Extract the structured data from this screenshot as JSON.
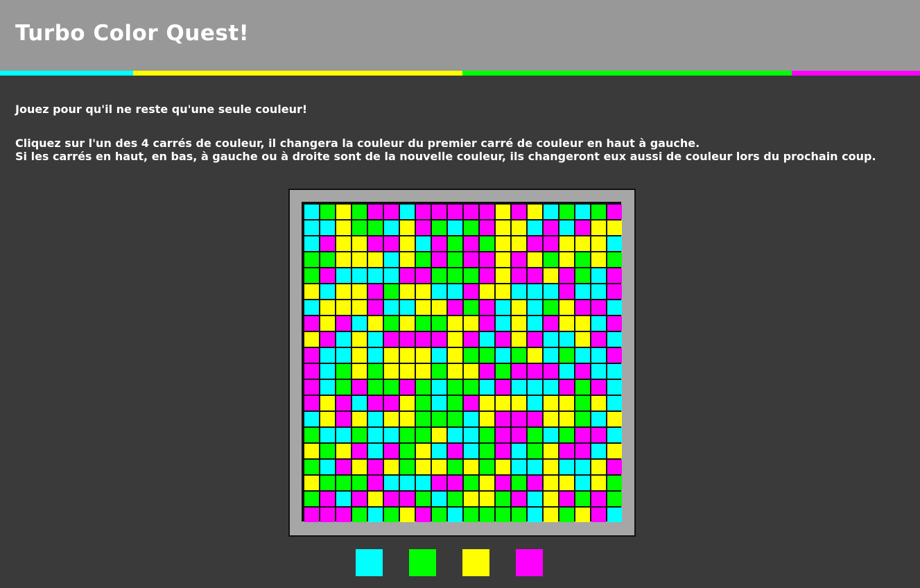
{
  "header": {
    "title": "Turbo Color Quest!",
    "stripe": [
      {
        "color": "#00ffff",
        "share": 192
      },
      {
        "color": "#ffff00",
        "share": 475
      },
      {
        "color": "#00ff00",
        "share": 475
      },
      {
        "color": "#ff00ff",
        "share": 185
      }
    ]
  },
  "instructions": {
    "line1": "Jouez pour qu'il ne reste qu'une seule couleur!",
    "line2": "Cliquez sur l'un des 4 carrés de couleur, il changera la couleur du premier carré de couleur en haut à gauche.",
    "line3": "Si les carrés en haut, en bas, à gauche ou à droite sont de la nouvelle couleur, ils changeront eux aussi de couleur lors du prochain coup."
  },
  "palette": {
    "C": "#00ffff",
    "G": "#00ff00",
    "Y": "#ffff00",
    "M": "#ff00ff"
  },
  "board": {
    "rows": [
      "CGYGMMCMMMMMYMYCGCGM",
      "CCYGGCYMGCGMYYCMCMYY",
      "CMYYMMYCMGMGYYMMYYYC",
      "GGYYYCYGMGMMYMYGYGYG",
      "GMCCCCMMGGGMYMMYMGCM",
      "YCYYMGYYCCMYYCCCMCCM",
      "CYYYMCCYYMGMCYCGYMMC",
      "MYMCYGYGGYYMCYCMYYCM",
      "YMCYCMMMMYMCMYMCCYMC",
      "MCCYCYYYCYGGCGYCGCCM",
      "MCGYGYYYGYYMGMMMCMCC",
      "MCGMGGMGCGGCMCCCMGMC",
      "MYMCMMYGCGMYYYCYYGYC",
      "CYMYCYYGGGCYMMMYYGCY",
      "GCCGCCGGYCCGMMGCGMMC",
      "YGYMCMGYCMCGMCGYMMCY",
      "GCMYMYGYYGYGYCCYCCYM",
      "YGGGMCCCMMGYMGMYYCYG",
      "GMCMYMMGCGYYGMCYMGMG",
      "MMMGCGYMGCGGGGCYGYMC"
    ]
  },
  "picker": [
    {
      "color": "#00ffff",
      "name": "cyan"
    },
    {
      "color": "#00ff00",
      "name": "green"
    },
    {
      "color": "#ffff00",
      "name": "yellow"
    },
    {
      "color": "#ff00ff",
      "name": "magenta"
    }
  ]
}
